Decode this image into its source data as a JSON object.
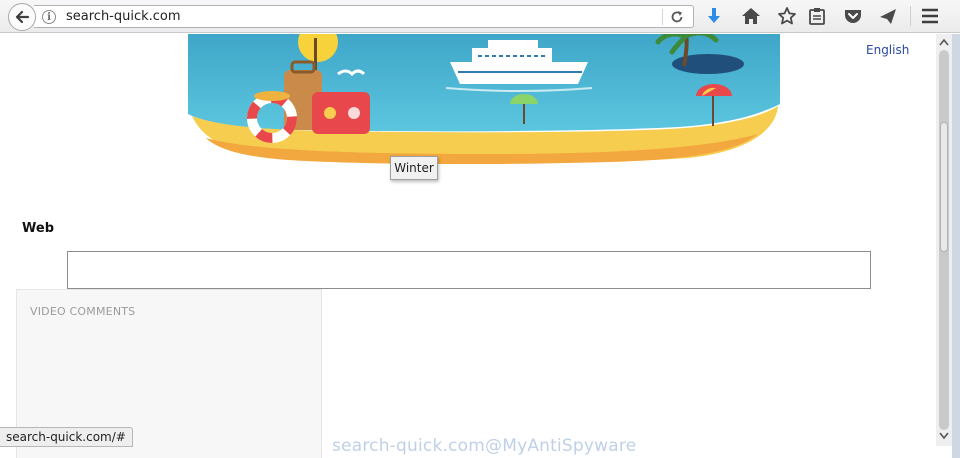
{
  "browser": {
    "url": "search-quick.com",
    "icons": {
      "back": "back-arrow-icon",
      "info": "info-icon",
      "reload": "reload-icon",
      "download": "download-arrow-icon",
      "home": "home-icon",
      "bookmark": "star-icon",
      "reader": "clipboard-icon",
      "pocket": "pocket-icon",
      "send": "send-tab-icon",
      "menu": "hamburger-menu-icon"
    }
  },
  "page": {
    "language_link": "English",
    "banner_tooltip": "Winter",
    "web_label": "Web",
    "search_value": "",
    "video_comments_title": "VIDEO COMMENTS"
  },
  "status_bar": {
    "link_url": "search-quick.com/#"
  },
  "watermark": "search-quick.com@MyAntiSpyware",
  "colors": {
    "link": "#2a47a6",
    "download_accent": "#2d8ce3",
    "sea": "#47b3d3",
    "sand": "#f6cd4f"
  }
}
